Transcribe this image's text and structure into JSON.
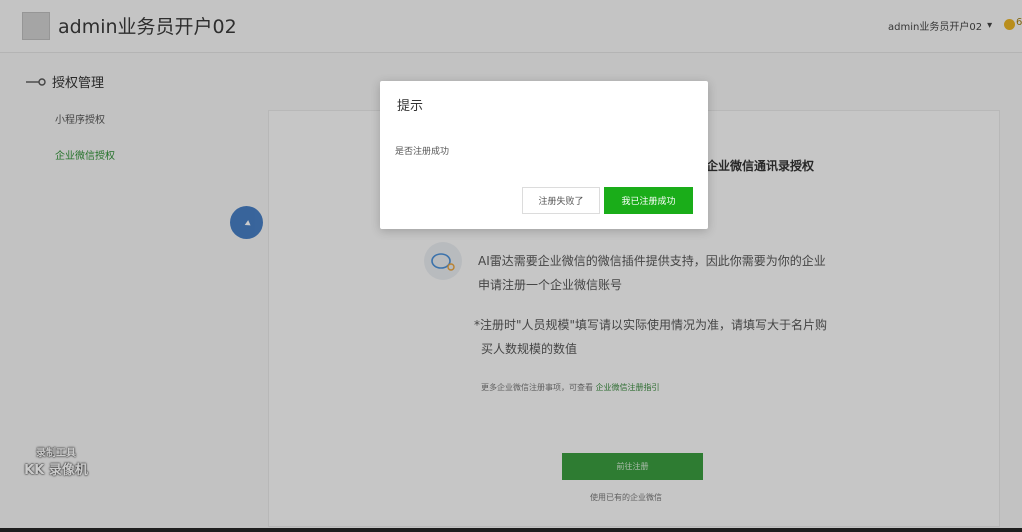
{
  "header": {
    "title": "admin业务员开户02",
    "user_name": "admin业务员开户02",
    "user_caret": "▾",
    "coin_label": "6"
  },
  "sidebar": {
    "section_title": "授权管理",
    "items": [
      {
        "label": "小程序授权",
        "active": false
      },
      {
        "label": "企业微信授权",
        "active": true
      }
    ]
  },
  "main": {
    "partial_title": "企业微信通讯录授权",
    "paragraph1": [
      "AI雷达需要企业微信的微信插件提供支持，因此你需要为你的企业",
      "申请注册一个企业微信账号"
    ],
    "paragraph2": [
      "*注册时\"人员规模\"填写请以实际使用情况为准，请填写大于名片购",
      "买人数规模的数值"
    ],
    "more_info_prefix": "更多企业微信注册事项，可查看",
    "more_info_link": "企业微信注册指引",
    "go_register_label": "前往注册",
    "use_existing_label": "使用已有的企业微信"
  },
  "watermark": {
    "line1": "录制工具",
    "line2": "KK 录像机"
  },
  "modal": {
    "title": "提示",
    "message": "是否注册成功",
    "fail_label": "注册失败了",
    "success_label": "我已注册成功"
  },
  "colors": {
    "primary_green": "#1aad19",
    "active_link": "#2e8f34",
    "cursor_blue": "#3e78c0"
  }
}
